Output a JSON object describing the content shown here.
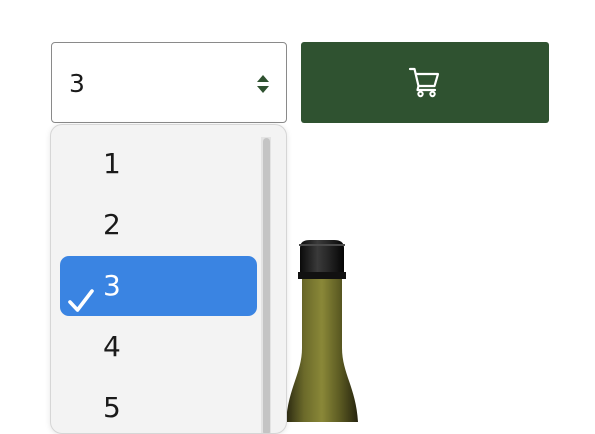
{
  "quantity_select": {
    "value": "3",
    "arrows_icon": "up-down-chevron-icon"
  },
  "cart_button": {
    "icon": "shopping-cart-icon",
    "color": "#2f5230"
  },
  "dropdown": {
    "options": [
      {
        "label": "1",
        "selected": false
      },
      {
        "label": "2",
        "selected": false
      },
      {
        "label": "3",
        "selected": true
      },
      {
        "label": "4",
        "selected": false
      },
      {
        "label": "5",
        "selected": false
      }
    ],
    "selected_color": "#3a84e2",
    "check_icon": "checkmark-icon"
  },
  "product_image": {
    "icon": "wine-bottle"
  }
}
